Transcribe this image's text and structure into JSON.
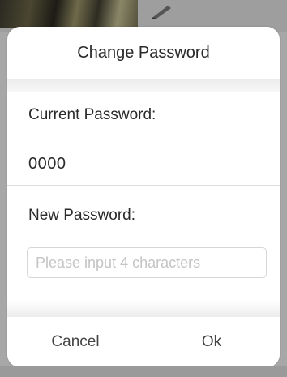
{
  "dialog": {
    "title": "Change Password",
    "current_password_label": "Current Password:",
    "current_password_value": "0000",
    "new_password_label": "New Password:",
    "new_password_placeholder": "Please input 4 characters",
    "new_password_value": "",
    "cancel_label": "Cancel",
    "ok_label": "Ok"
  },
  "icons": {
    "background_tool": "pencil-icon"
  },
  "colors": {
    "overlay": "#a7a7a7",
    "dialog_background": "#ffffff",
    "text": "#2a2a2a",
    "placeholder": "#c4c4c4",
    "separator": "#dcdcdc"
  }
}
